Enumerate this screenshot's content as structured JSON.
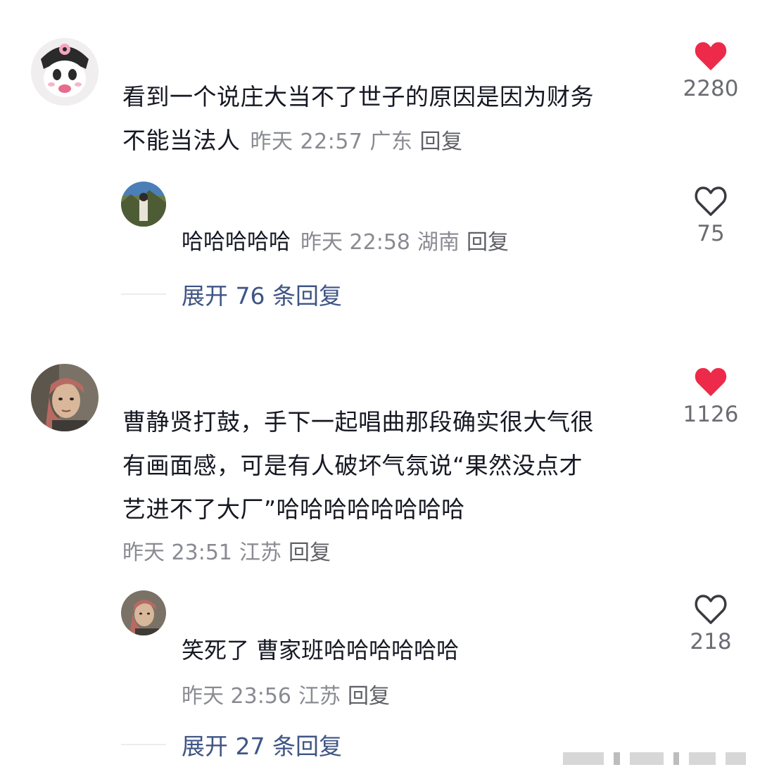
{
  "comments": [
    {
      "text": "看到一个说庄大当不了世子的原因是因为财务不能当法人",
      "line1": "看到一个说庄大当不了世子的原因是因为财务",
      "line2": "不能当法人",
      "time": "昨天 22:57",
      "location": "广东",
      "reply_label": "回复",
      "likes": "2280",
      "liked": true,
      "avatar_icon": "kuromi-avatar-icon",
      "replies": [
        {
          "text": "哈哈哈哈哈",
          "time": "昨天 22:58",
          "location": "湖南",
          "reply_label": "回复",
          "likes": "75",
          "liked": false
        }
      ],
      "expand_label": "展开 76 条回复"
    },
    {
      "text": "曹静贤打鼓，手下一起唱曲那段确实很大气很有画面感，可是有人破坏气氛说“果然没点才艺进不了大厂”哈哈哈哈哈哈哈哈",
      "line1": "曹静贤打鼓，手下一起唱曲那段确实很大气很",
      "line2": "有画面感，可是有人破坏气氛说“果然没点才",
      "line3": "艺进不了大厂”哈哈哈哈哈哈哈哈",
      "time": "昨天 23:51",
      "location": "江苏",
      "reply_label": "回复",
      "likes": "1126",
      "liked": true,
      "replies": [
        {
          "text": "笑死了 曹家班哈哈哈哈哈哈",
          "time": "昨天 23:56",
          "location": "江苏",
          "reply_label": "回复",
          "likes": "218",
          "liked": false
        }
      ],
      "expand_label": "展开 27 条回复"
    }
  ],
  "colors": {
    "liked_heart": "#ee2a4a",
    "unliked_heart": "#3a3b40",
    "expand_link": "#3f5585",
    "meta_gray": "#8a8b91"
  }
}
